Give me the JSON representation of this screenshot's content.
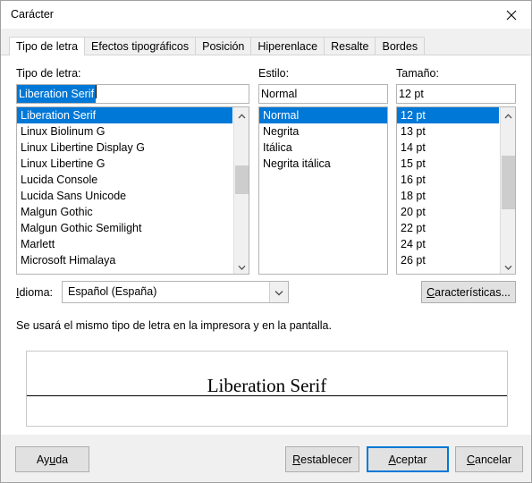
{
  "window": {
    "title": "Carácter",
    "close_icon": "close-icon"
  },
  "tabs": [
    {
      "label": "Tipo de letra",
      "active": true
    },
    {
      "label": "Efectos tipográficos",
      "active": false
    },
    {
      "label": "Posición",
      "active": false
    },
    {
      "label": "Hiperenlace",
      "active": false
    },
    {
      "label": "Resalte",
      "active": false
    },
    {
      "label": "Bordes",
      "active": false
    }
  ],
  "font": {
    "label": "Tipo de letra:",
    "value": "Liberation Serif",
    "items": [
      "Liberation Serif",
      "Linux Biolinum G",
      "Linux Libertine Display G",
      "Linux Libertine G",
      "Lucida Console",
      "Lucida Sans Unicode",
      "Malgun Gothic",
      "Malgun Gothic Semilight",
      "Marlett",
      "Microsoft Himalaya"
    ],
    "selected_index": 0
  },
  "style": {
    "label": "Estilo:",
    "value": "Normal",
    "items": [
      "Normal",
      "Negrita",
      "Itálica",
      "Negrita itálica"
    ],
    "selected_index": 0
  },
  "size": {
    "label": "Tamaño:",
    "value": "12 pt",
    "items": [
      "12 pt",
      "13 pt",
      "14 pt",
      "15 pt",
      "16 pt",
      "18 pt",
      "20 pt",
      "22 pt",
      "24 pt",
      "26 pt"
    ],
    "selected_index": 0
  },
  "language": {
    "label_prefix": "I",
    "label_rest": "dioma:",
    "value": "Español (España)",
    "arrow_icon": "chevron-down-icon"
  },
  "features_button": {
    "accel": "C",
    "rest": "aracterísticas..."
  },
  "hint": "Se usará el mismo tipo de letra en la impresora y en la pantalla.",
  "preview": {
    "text": "Liberation Serif"
  },
  "footer": {
    "help": {
      "pre": "Ay",
      "accel": "u",
      "post": "da"
    },
    "reset": {
      "accel": "R",
      "rest": "establecer"
    },
    "ok": {
      "accel": "A",
      "rest": "ceptar"
    },
    "cancel": {
      "accel": "C",
      "rest": "ancelar"
    }
  },
  "colors": {
    "accent": "#0078d7",
    "dialog_bg": "#f0f0f0",
    "page_bg": "#ffffff",
    "button_bg": "#e1e1e1"
  }
}
